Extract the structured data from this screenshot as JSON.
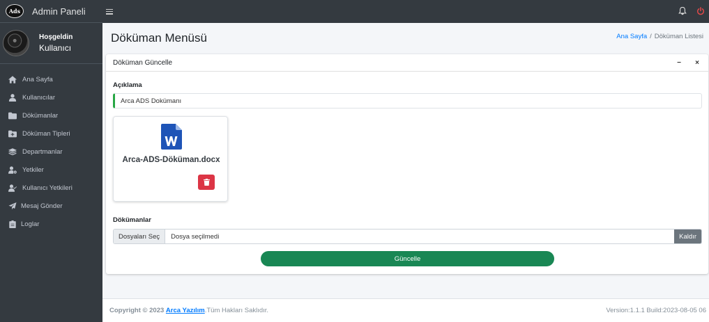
{
  "brand": {
    "logo_text": "Ads",
    "title": "Admin Paneli"
  },
  "user": {
    "greeting": "Hoşgeldin",
    "name": "Kullanıcı"
  },
  "sidebar": {
    "items": [
      {
        "label": "Ana Sayfa",
        "icon": "home-icon"
      },
      {
        "label": "Kullanıcılar",
        "icon": "user-icon"
      },
      {
        "label": "Dökümanlar",
        "icon": "folder-icon"
      },
      {
        "label": "Döküman Tipleri",
        "icon": "folder-plus-icon"
      },
      {
        "label": "Departmanlar",
        "icon": "layers-icon"
      },
      {
        "label": "Yetkiler",
        "icon": "user-cog-icon"
      },
      {
        "label": "Kullanıcı Yetkileri",
        "icon": "user-check-icon"
      },
      {
        "label": "Mesaj Gönder",
        "icon": "paper-plane-icon"
      },
      {
        "label": "Loglar",
        "icon": "clipboard-icon"
      }
    ]
  },
  "topbar": {
    "menu_icon": "hamburger-icon",
    "bell_icon": "bell-icon",
    "power_icon": "power-icon"
  },
  "header": {
    "title": "Döküman Menüsü",
    "breadcrumb": {
      "home": "Ana Sayfa",
      "separator": "/",
      "current": "Döküman Listesi"
    }
  },
  "card": {
    "title": "Döküman Güncelle",
    "minimize": "−",
    "close": "×",
    "description_label": "Açıklama",
    "description_value": "Arca ADS Dokümanı",
    "document": {
      "file_name": "Arca-ADS-Döküman.docx",
      "icon": "word-file-icon",
      "delete_icon": "trash-icon"
    },
    "documents_label": "Dökümanlar",
    "file_input": {
      "select_label": "Dosyaları Seç",
      "status": "Dosya seçilmedi",
      "remove_label": "Kaldır"
    },
    "submit_label": "Güncelle"
  },
  "footer": {
    "copyright_prefix": "Copyright © 2023",
    "company": "Arca Yazılım",
    "rights": ".Tüm Hakları Saklıdır.",
    "version": "Version:1.1.1 Build:2023-08-05 06"
  },
  "colors": {
    "sidebar": "#343a40",
    "accent_green": "#198754",
    "danger": "#dc3545",
    "link": "#007bff",
    "word_blue": "#1e54b7"
  }
}
